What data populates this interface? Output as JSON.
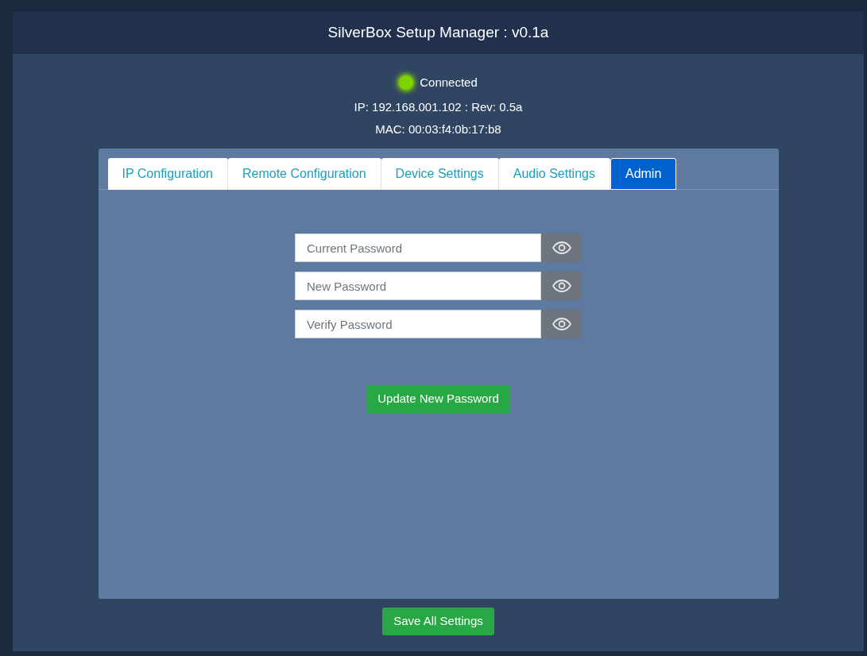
{
  "window": {
    "title": "SilverBox Setup Manager : v0.1a"
  },
  "status": {
    "label": "Connected",
    "connected": true
  },
  "info": [
    "IP: 192.168.001.102 : Rev: 0.5a",
    "MAC: 00:03:f4:0b:17:b8"
  ],
  "tabs": [
    {
      "label": "IP Configuration",
      "selected": false
    },
    {
      "label": "Remote Configuration",
      "selected": false
    },
    {
      "label": "Device Settings",
      "selected": false
    },
    {
      "label": "Audio Settings",
      "selected": false
    },
    {
      "label": "Admin",
      "selected": true
    }
  ],
  "password_fields": [
    {
      "placeholder": "Current Password"
    },
    {
      "placeholder": "New Password"
    },
    {
      "placeholder": "Verify Password"
    }
  ],
  "update_button": "Update New Password",
  "save_button": "Save All Settings"
}
